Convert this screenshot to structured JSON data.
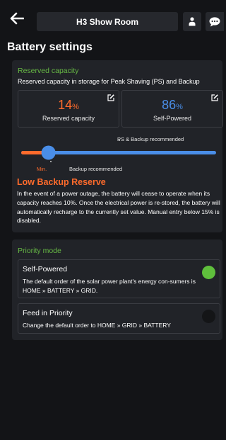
{
  "header": {
    "title": "H3 Show Room"
  },
  "page": {
    "title": "Battery settings"
  },
  "reserved": {
    "section_title": "Reserved capacity",
    "subtitle": "Reserved capacity in storage for Peak Shaving (PS) and Backup",
    "reserved_value": "14",
    "reserved_unit": "%",
    "reserved_label": "Reserved capacity",
    "self_value": "86",
    "self_unit": "%",
    "self_label": "Self-Powered",
    "slider_fraction": 0.14,
    "ps_backup_recommended": "PS & Backup recommended",
    "min_label": "Min.",
    "backup_recommended": "Backup recommended",
    "warning_title": "Low Backup Reserve",
    "warning_text": "In the event of a power outage, the battery will cease to operate when its capacity reaches 10%. Once the electrical power is re-stored, the battery will automatically recharge to the currently set value. Manual entry below 15% is disabled."
  },
  "priority": {
    "section_title": "Priority mode",
    "modes": [
      {
        "title": "Self-Powered",
        "desc": "The default order of the solar power plant's energy con-sumers is HOME » BATTERY » GRID.",
        "active": true
      },
      {
        "title": "Feed in Priority",
        "desc": "Change the default order to HOME » GRID » BATTERY",
        "active": false
      }
    ]
  },
  "colors": {
    "accent_orange": "#ff6b2c",
    "accent_blue": "#4a8ee8",
    "accent_green": "#5fbf3c",
    "section_green": "#67b845"
  }
}
